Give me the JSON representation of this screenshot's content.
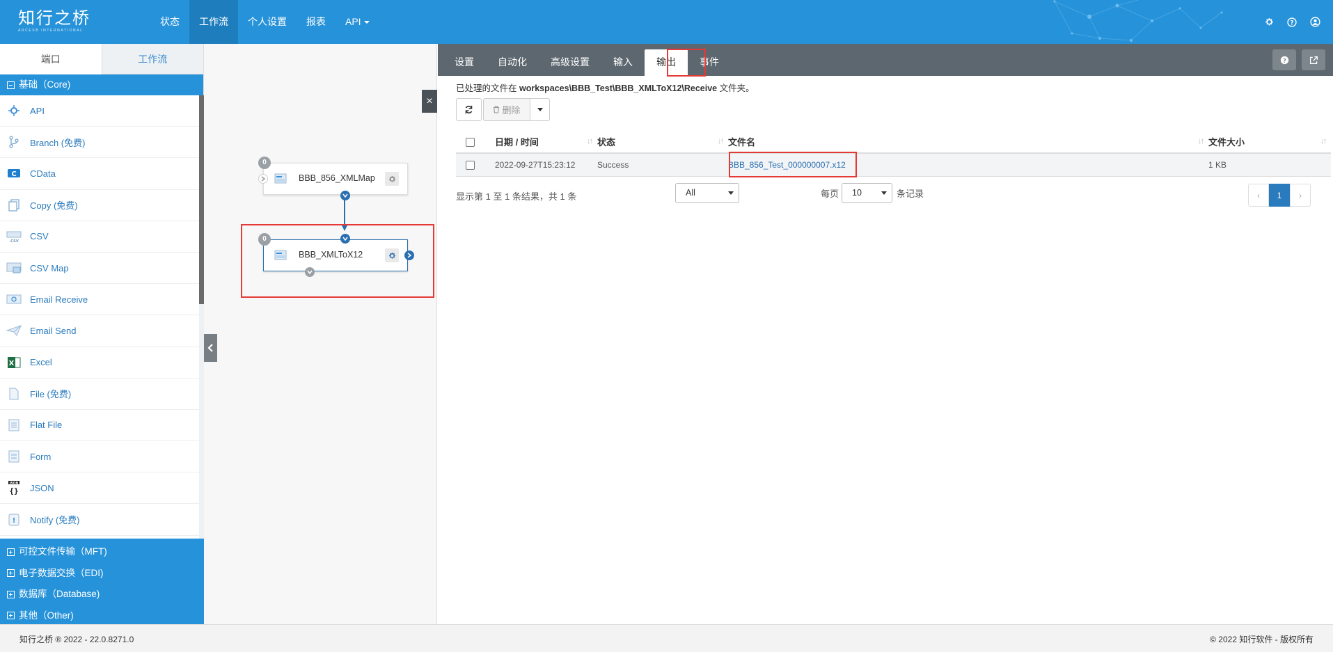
{
  "brand": {
    "name_cn": "知行之桥",
    "name_en": "ARCESB INTERNATIONAL"
  },
  "nav": {
    "items": [
      {
        "label": "状态"
      },
      {
        "label": "工作流",
        "active": true
      },
      {
        "label": "个人设置"
      },
      {
        "label": "报表"
      },
      {
        "label": "API"
      }
    ],
    "icons": [
      "gear-icon",
      "help-icon",
      "user-icon"
    ]
  },
  "sidebar": {
    "tabs": [
      "端口",
      "工作流"
    ],
    "core_category": "基础（Core)",
    "connectors": [
      {
        "label": "API",
        "icon": "api-icon"
      },
      {
        "label": "Branch (免费)",
        "icon": "branch-icon"
      },
      {
        "label": "CData",
        "icon": "cdata-icon"
      },
      {
        "label": "Copy (免费)",
        "icon": "copy-icon"
      },
      {
        "label": "CSV",
        "icon": "csv-icon"
      },
      {
        "label": "CSV Map",
        "icon": "csv-map-icon"
      },
      {
        "label": "Email Receive",
        "icon": "email-receive-icon"
      },
      {
        "label": "Email Send",
        "icon": "email-send-icon"
      },
      {
        "label": "Excel",
        "icon": "excel-icon"
      },
      {
        "label": "File (免费)",
        "icon": "file-icon"
      },
      {
        "label": "Flat File",
        "icon": "flat-file-icon"
      },
      {
        "label": "Form",
        "icon": "form-icon"
      },
      {
        "label": "JSON",
        "icon": "json-icon"
      },
      {
        "label": "Notify (免费)",
        "icon": "notify-icon"
      }
    ],
    "other_categories": [
      "可控文件传输（MFT)",
      "电子数据交换（EDI)",
      "数据库（Database)",
      "其他（Other)"
    ]
  },
  "canvas": {
    "nodes": [
      {
        "label": "BBB_856_XMLMap",
        "badge": "0"
      },
      {
        "label": "BBB_XMLToX12",
        "badge": "0"
      }
    ]
  },
  "panel": {
    "tabs": [
      "设置",
      "自动化",
      "高级设置",
      "输入",
      "输出",
      "事件"
    ],
    "active_tab": "输出",
    "folder_prefix": "已处理的文件在",
    "folder_path": "workspaces\\BBB_Test\\BBB_XMLToX12\\Receive",
    "folder_suffix": "文件夹。",
    "delete_label": "删除",
    "table": {
      "headers": [
        "日期 / 时间",
        "状态",
        "文件名",
        "文件大小"
      ],
      "rows": [
        {
          "date": "2022-09-27T15:23:12",
          "status": "Success",
          "filename": "BBB_856_Test_000000007.x12",
          "size": "1 KB"
        }
      ]
    },
    "info": "显示第 1 至 1 条结果，共 1 条",
    "filter_value": "All",
    "per_page_prefix": "每页",
    "per_page_value": "10",
    "per_page_suffix": "条记录",
    "pager": {
      "prev": "‹",
      "current": "1",
      "next": "›"
    }
  },
  "footer": {
    "left": "知行之桥 ® 2022 - 22.0.8271.0",
    "right": "© 2022 知行软件 - 版权所有"
  },
  "colors": {
    "primary": "#2692d9",
    "highlight": "#e53935",
    "panel_bar": "#5d676f"
  }
}
